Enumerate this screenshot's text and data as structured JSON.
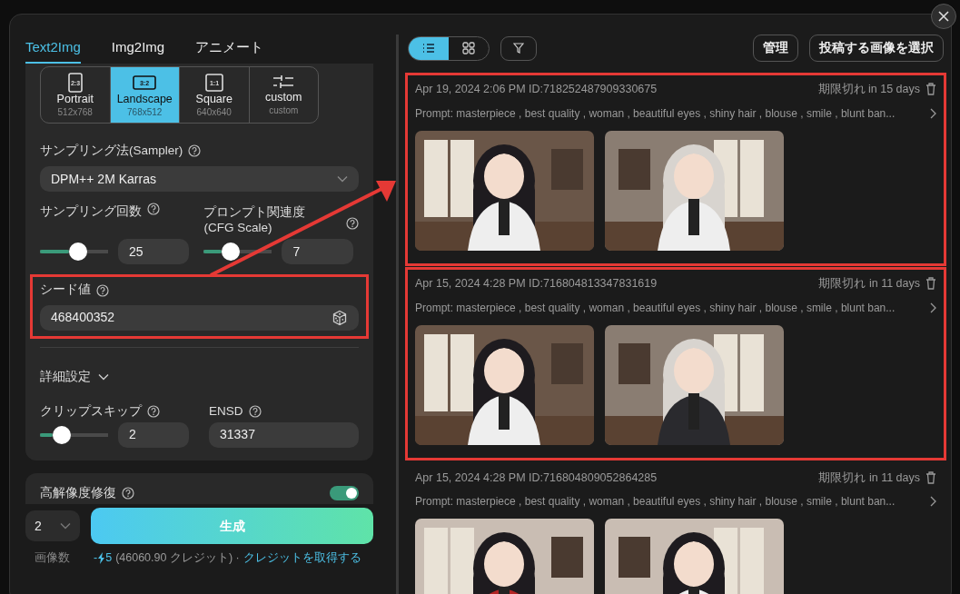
{
  "tabs": [
    {
      "label": "Text2Img",
      "selected": true
    },
    {
      "label": "Img2Img",
      "selected": false
    },
    {
      "label": "アニメート",
      "selected": false
    }
  ],
  "aspect_options": [
    {
      "kind": "portrait",
      "ratio": "2:3",
      "label": "Portrait",
      "size": "512x768",
      "selected": false
    },
    {
      "kind": "landscape",
      "ratio": "3:2",
      "label": "Landscape",
      "size": "768x512",
      "selected": true
    },
    {
      "kind": "square",
      "ratio": "1:1",
      "label": "Square",
      "size": "640x640",
      "selected": false
    },
    {
      "kind": "custom",
      "label": "custom",
      "size": "custom",
      "selected": false
    }
  ],
  "sampler": {
    "label": "サンプリング法(Sampler)",
    "value": "DPM++ 2M Karras"
  },
  "sampling_steps": {
    "label": "サンプリング回数",
    "level": 0.43,
    "value": "25"
  },
  "cfg_scale": {
    "label": "プロンプト関連度 (CFG Scale)",
    "level": 0.26,
    "value": "7"
  },
  "seed": {
    "label": "シード値",
    "value": "468400352",
    "highlighted": true
  },
  "advanced": {
    "label": "詳細設定"
  },
  "clip_skip": {
    "label": "クリップスキップ",
    "level": 0.18,
    "value": "2"
  },
  "ensd": {
    "label": "ENSD",
    "value": "31337"
  },
  "hires_fix": {
    "label": "高解像度修復",
    "on": true
  },
  "image_count": {
    "value": "2",
    "label": "画像数"
  },
  "generate_button": "生成",
  "cost": {
    "prefix": "-",
    "value": "5",
    "balance": "(46060.90 クレジット) ·",
    "link": "クレジットを取得する"
  },
  "toolbar": {
    "views": [
      {
        "kind": "list",
        "selected": true
      },
      {
        "kind": "grid",
        "selected": false
      }
    ],
    "buttons": [
      "管理",
      "投稿する画像を選択"
    ]
  },
  "history": [
    {
      "meta": "Apr 19, 2024 2:06 PM ID:718252487909330675",
      "expiry": "期限切れ in 15 days",
      "prompt": "Prompt: masterpiece , best quality , woman , beautiful eyes , shiny hair , blouse , smile , blunt ban...",
      "highlighted": true
    },
    {
      "meta": "Apr 15, 2024 4:28 PM ID:716804813347831619",
      "expiry": "期限切れ in 11 days",
      "prompt": "Prompt: masterpiece , best quality , woman , beautiful eyes , shiny hair , blouse , smile , blunt ban...",
      "highlighted": true
    },
    {
      "meta": "Apr 15, 2024 4:28 PM ID:716804809052864285",
      "expiry": "期限切れ in 11 days",
      "prompt": "Prompt: masterpiece , best quality , woman , beautiful eyes , shiny hair , blouse , smile , blunt ban...",
      "highlighted": false
    }
  ]
}
